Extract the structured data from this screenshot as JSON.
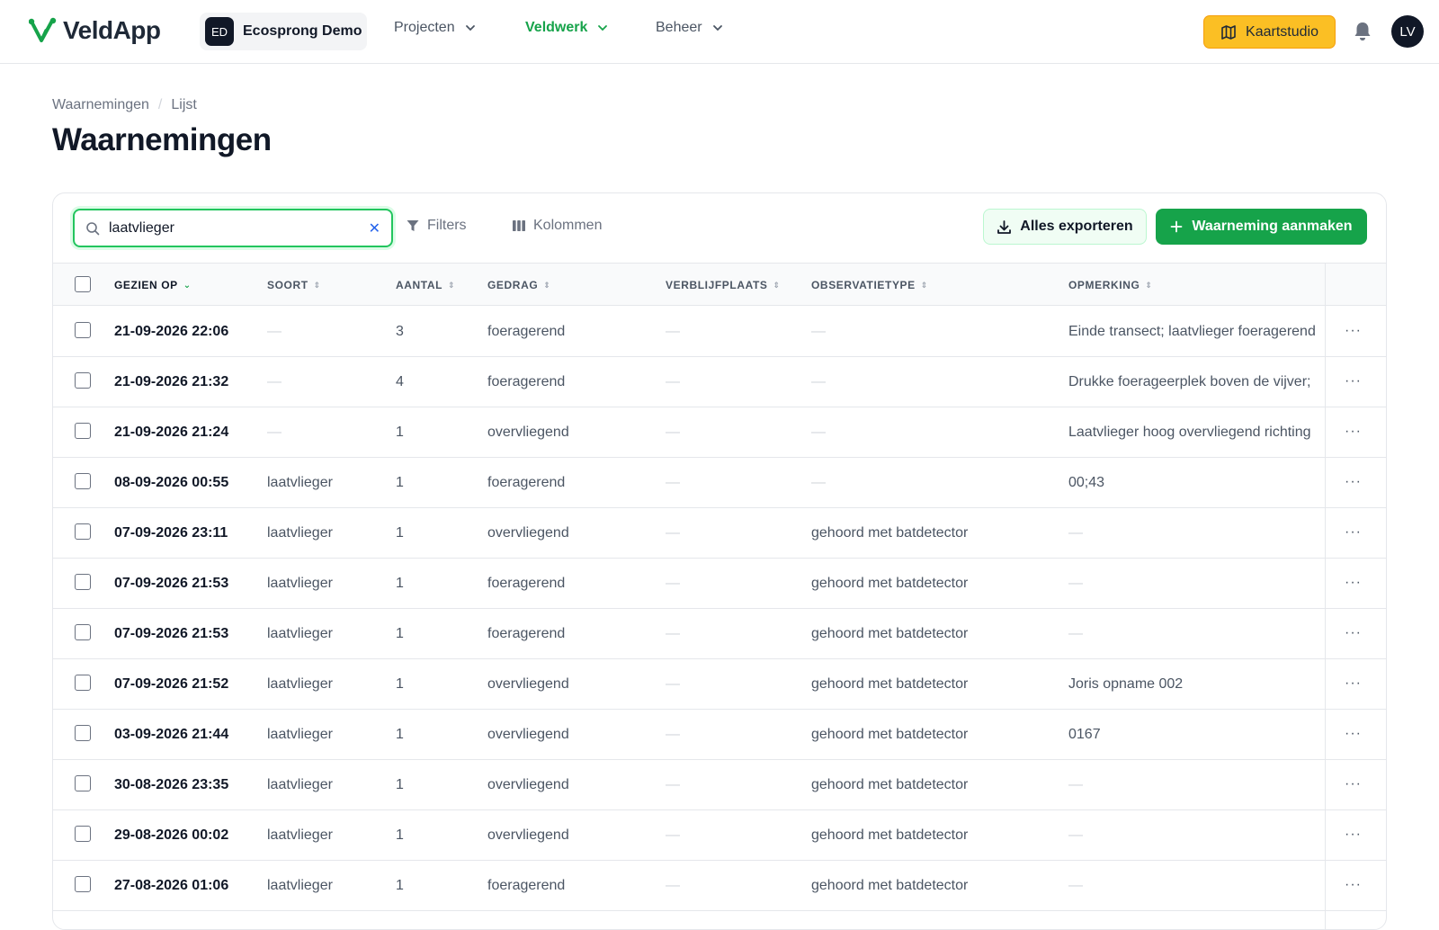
{
  "header": {
    "app_name": "VeldApp",
    "org_initials": "ED",
    "org_name": "Ecosprong Demo",
    "nav": [
      {
        "label": "Projecten"
      },
      {
        "label": "Veldwerk"
      },
      {
        "label": "Beheer"
      }
    ],
    "kaartstudio_label": "Kaartstudio",
    "user_initials": "LV"
  },
  "breadcrumb": [
    "Waarnemingen",
    "Lijst"
  ],
  "page_title": "Waarnemingen",
  "toolbar": {
    "search_value": "laatvlieger",
    "filters_label": "Filters",
    "columns_label": "Kolommen",
    "export_label": "Alles exporteren",
    "create_label": "Waarneming aanmaken"
  },
  "table": {
    "columns": [
      "GEZIEN OP",
      "SOORT",
      "AANTAL",
      "GEDRAG",
      "VERBLIJFPLAATS",
      "OBSERVATIETYPE",
      "OPMERKING"
    ],
    "rows": [
      {
        "date": "21-09-2026 22:06",
        "soort": "—",
        "aantal": "3",
        "gedrag": "foeragerend",
        "verblijf": "—",
        "obs": "—",
        "opm": "Einde transect; laatvlieger foeragerend"
      },
      {
        "date": "21-09-2026 21:32",
        "soort": "—",
        "aantal": "4",
        "gedrag": "foeragerend",
        "verblijf": "—",
        "obs": "—",
        "opm": "Drukke foerageerplek boven de vijver;"
      },
      {
        "date": "21-09-2026 21:24",
        "soort": "—",
        "aantal": "1",
        "gedrag": "overvliegend",
        "verblijf": "—",
        "obs": "—",
        "opm": "Laatvlieger hoog overvliegend richting"
      },
      {
        "date": "08-09-2026 00:55",
        "soort": "laatvlieger",
        "aantal": "1",
        "gedrag": "foeragerend",
        "verblijf": "—",
        "obs": "—",
        "opm": "00;43"
      },
      {
        "date": "07-09-2026 23:11",
        "soort": "laatvlieger",
        "aantal": "1",
        "gedrag": "overvliegend",
        "verblijf": "—",
        "obs": "gehoord met batdetector",
        "opm": "—"
      },
      {
        "date": "07-09-2026 21:53",
        "soort": "laatvlieger",
        "aantal": "1",
        "gedrag": "foeragerend",
        "verblijf": "—",
        "obs": "gehoord met batdetector",
        "opm": "—"
      },
      {
        "date": "07-09-2026 21:53",
        "soort": "laatvlieger",
        "aantal": "1",
        "gedrag": "foeragerend",
        "verblijf": "—",
        "obs": "gehoord met batdetector",
        "opm": "—"
      },
      {
        "date": "07-09-2026 21:52",
        "soort": "laatvlieger",
        "aantal": "1",
        "gedrag": "overvliegend",
        "verblijf": "—",
        "obs": "gehoord met batdetector",
        "opm": "Joris opname 002"
      },
      {
        "date": "03-09-2026 21:44",
        "soort": "laatvlieger",
        "aantal": "1",
        "gedrag": "overvliegend",
        "verblijf": "—",
        "obs": "gehoord met batdetector",
        "opm": "0167"
      },
      {
        "date": "30-08-2026 23:35",
        "soort": "laatvlieger",
        "aantal": "1",
        "gedrag": "overvliegend",
        "verblijf": "—",
        "obs": "gehoord met batdetector",
        "opm": "—"
      },
      {
        "date": "29-08-2026 00:02",
        "soort": "laatvlieger",
        "aantal": "1",
        "gedrag": "overvliegend",
        "verblijf": "—",
        "obs": "gehoord met batdetector",
        "opm": "—"
      },
      {
        "date": "27-08-2026 01:06",
        "soort": "laatvlieger",
        "aantal": "1",
        "gedrag": "foeragerend",
        "verblijf": "—",
        "obs": "gehoord met batdetector",
        "opm": "—"
      }
    ]
  },
  "colors": {
    "brand_green": "#16a34a",
    "accent_yellow": "#fbbf24"
  }
}
